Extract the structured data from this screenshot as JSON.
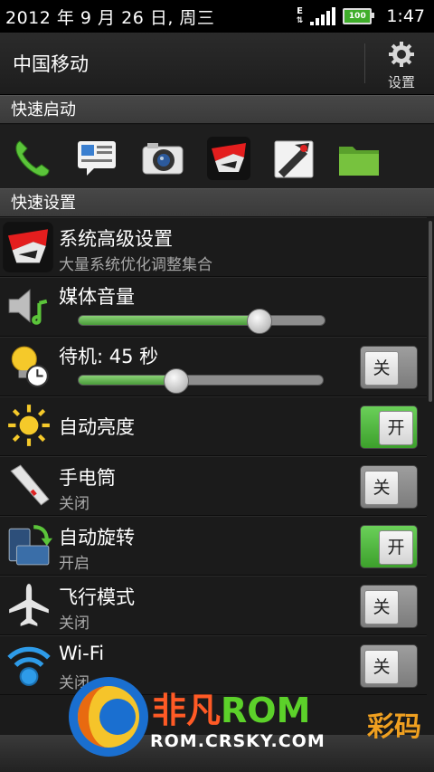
{
  "status": {
    "date": "2012 年 9 月 26 日, 周三",
    "network": "E",
    "battery": "100",
    "time": "1:47"
  },
  "carrier": {
    "name": "中国移动",
    "settings_label": "设置"
  },
  "sections": {
    "quick_launch": "快速启动",
    "quick_settings": "快速设置"
  },
  "quick_launch": [
    {
      "icon": "phone-icon"
    },
    {
      "icon": "messages-icon"
    },
    {
      "icon": "camera-icon"
    },
    {
      "icon": "app-icon"
    },
    {
      "icon": "tool-icon"
    },
    {
      "icon": "folder-icon"
    }
  ],
  "settings": {
    "advanced": {
      "title": "系统高级设置",
      "subtitle": "大量系统优化调整集合"
    },
    "media_volume": {
      "title": "媒体音量",
      "level": 0.73
    },
    "standby": {
      "title": "待机: 45 秒",
      "level": 0.39,
      "toggle": "关"
    },
    "auto_brightness": {
      "title": "自动亮度",
      "toggle": "开"
    },
    "flashlight": {
      "title": "手电筒",
      "subtitle": "关闭",
      "toggle": "关"
    },
    "auto_rotate": {
      "title": "自动旋转",
      "subtitle": "开启",
      "toggle": "开"
    },
    "airplane": {
      "title": "飞行模式",
      "subtitle": "关闭",
      "toggle": "关"
    },
    "wifi": {
      "title": "Wi-Fi",
      "subtitle": "关闭",
      "toggle": "关"
    }
  },
  "watermark": {
    "brand_prefix": "非凡",
    "brand_rom": "ROM",
    "url": "ROM.CRSKY.COM",
    "extra": "彩码"
  },
  "colors": {
    "toggle_on": "#4fb83a",
    "slider_fill": "#6fc15b"
  }
}
